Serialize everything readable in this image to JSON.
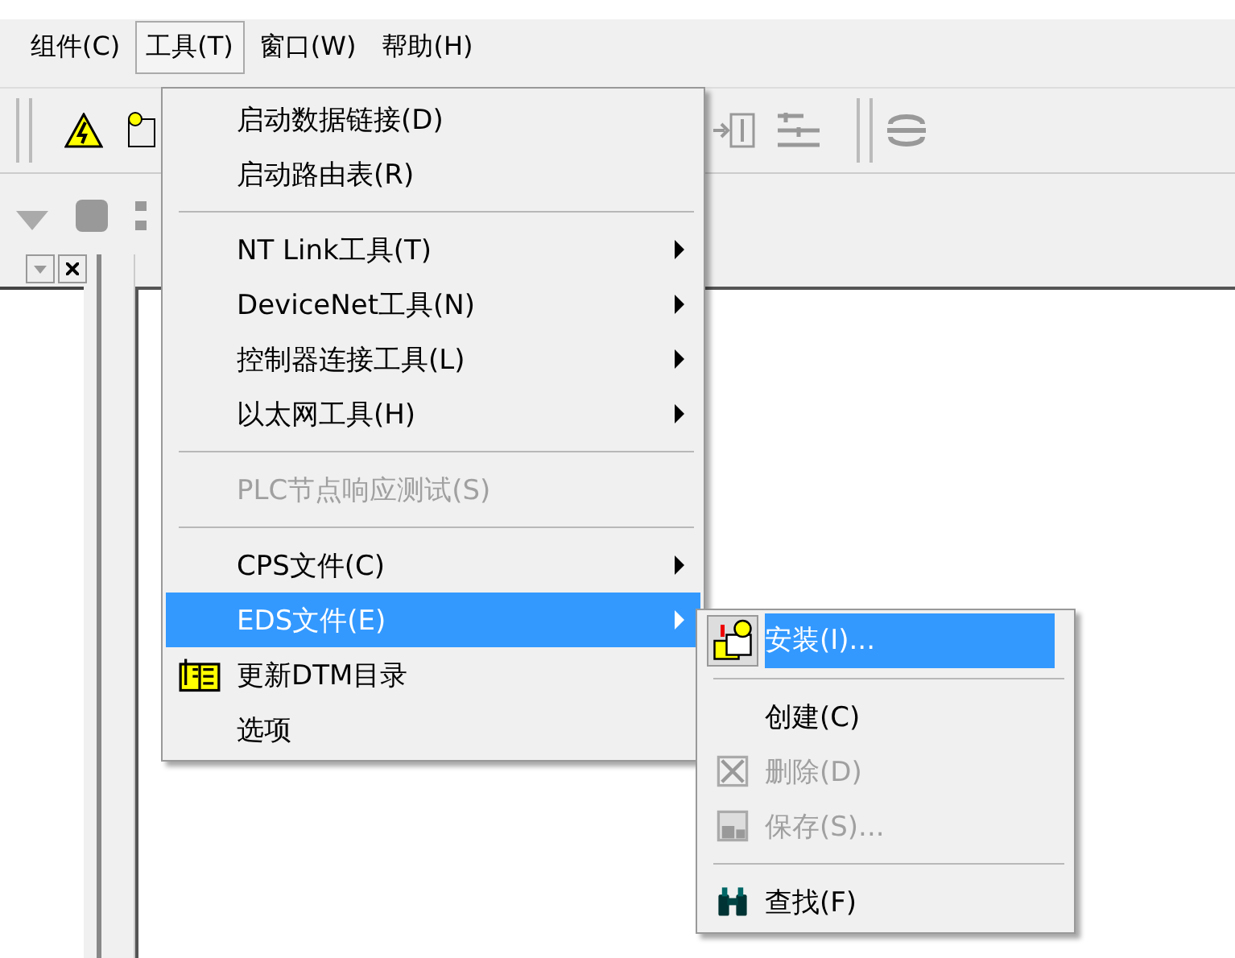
{
  "menu_bar": [
    {
      "label": "组件(C)",
      "selected": false
    },
    {
      "label": "工具(T)",
      "selected": true
    },
    {
      "label": "窗口(W)",
      "selected": false
    },
    {
      "label": "帮助(H)",
      "selected": false
    }
  ],
  "tools_menu": {
    "items": [
      {
        "kind": "item",
        "label": "启动数据链接(D)",
        "has_submenu": false,
        "disabled": false,
        "selected": false
      },
      {
        "kind": "item",
        "label": "启动路由表(R)",
        "has_submenu": false,
        "disabled": false,
        "selected": false
      },
      {
        "kind": "separator"
      },
      {
        "kind": "item",
        "label": "NT Link工具(T)",
        "has_submenu": true,
        "disabled": false,
        "selected": false
      },
      {
        "kind": "item",
        "label": "DeviceNet工具(N)",
        "has_submenu": true,
        "disabled": false,
        "selected": false
      },
      {
        "kind": "item",
        "label": "控制器连接工具(L)",
        "has_submenu": true,
        "disabled": false,
        "selected": false
      },
      {
        "kind": "item",
        "label": "以太网工具(H)",
        "has_submenu": true,
        "disabled": false,
        "selected": false
      },
      {
        "kind": "separator"
      },
      {
        "kind": "item",
        "label": "PLC节点响应测试(S)",
        "has_submenu": false,
        "disabled": true,
        "selected": false
      },
      {
        "kind": "separator"
      },
      {
        "kind": "item",
        "label": "CPS文件(C)",
        "has_submenu": true,
        "disabled": false,
        "selected": false
      },
      {
        "kind": "item",
        "label": "EDS文件(E)",
        "has_submenu": true,
        "disabled": false,
        "selected": true
      },
      {
        "kind": "item",
        "label": "更新DTM目录",
        "has_submenu": false,
        "disabled": false,
        "selected": false
      },
      {
        "kind": "item",
        "label": "选项",
        "has_submenu": false,
        "disabled": false,
        "selected": false
      }
    ]
  },
  "eds_submenu": {
    "items": [
      {
        "kind": "item",
        "label": "安装(I)...",
        "disabled": false,
        "selected": true
      },
      {
        "kind": "separator"
      },
      {
        "kind": "item",
        "label": "创建(C)",
        "disabled": false,
        "selected": false
      },
      {
        "kind": "item",
        "label": "删除(D)",
        "disabled": true,
        "selected": false
      },
      {
        "kind": "item",
        "label": "保存(S)...",
        "disabled": true,
        "selected": false
      },
      {
        "kind": "separator"
      },
      {
        "kind": "item",
        "label": "查找(F)",
        "disabled": false,
        "selected": false
      }
    ]
  }
}
